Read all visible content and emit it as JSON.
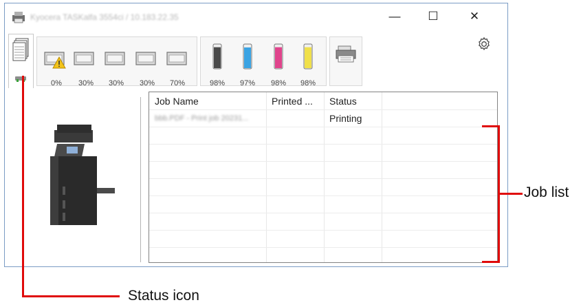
{
  "window": {
    "title": "Kyocera TASKalfa 3554ci / 10.183.22.35",
    "minimize_glyph": "—",
    "maximize_glyph": "☐",
    "close_glyph": "✕"
  },
  "toolbar": {
    "paper_levels": [
      "0%",
      "30%",
      "30%",
      "30%",
      "70%"
    ],
    "toner_levels": [
      "98%",
      "97%",
      "98%",
      "98%"
    ],
    "toner_colors": [
      "#4a4a4a",
      "#3aa3e3",
      "#e0448c",
      "#f0e04a"
    ],
    "expand_glyph": "︽",
    "icons": {
      "status": "status-pages-icon",
      "warning": "warning-icon",
      "settings": "gear-icon",
      "device": "printer-device-icon"
    }
  },
  "job_list": {
    "columns": [
      "Job Name",
      "Printed ...",
      "Status"
    ],
    "rows": [
      {
        "job_name": "bbb.PDF - Print job 20231...",
        "printed": "",
        "status": "Printing"
      }
    ]
  },
  "annotations": {
    "job_list_label": "Job list",
    "status_icon_label": "Status icon",
    "accent_color": "#e00a0a"
  }
}
